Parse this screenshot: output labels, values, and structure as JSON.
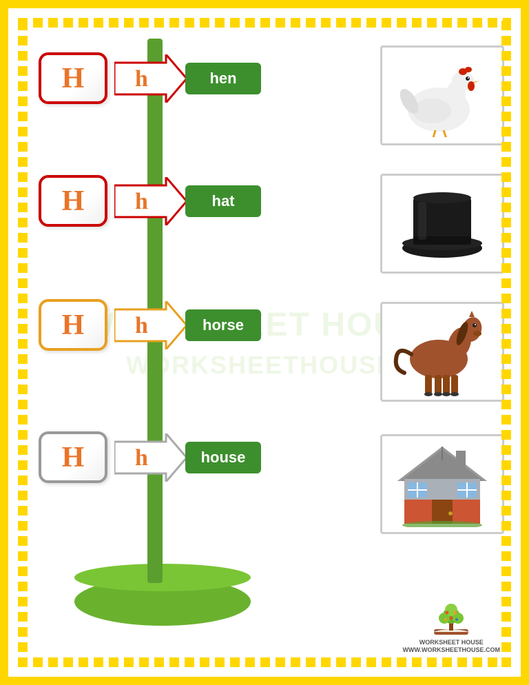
{
  "border": {
    "color": "gold"
  },
  "rows": [
    {
      "id": "row1",
      "capital": "H",
      "lowercase": "h",
      "word": "hen",
      "color_scheme": "red",
      "image_alt": "hen",
      "image_emoji": "🐓"
    },
    {
      "id": "row2",
      "capital": "H",
      "lowercase": "h",
      "word": "hat",
      "color_scheme": "red",
      "image_alt": "hat",
      "image_emoji": "🎩"
    },
    {
      "id": "row3",
      "capital": "H",
      "lowercase": "h",
      "word": "horse",
      "color_scheme": "orange",
      "image_alt": "horse",
      "image_emoji": "🐎"
    },
    {
      "id": "row4",
      "capital": "H",
      "lowercase": "h",
      "word": "house",
      "color_scheme": "gray",
      "image_alt": "house",
      "image_emoji": "🏠"
    }
  ],
  "watermark": {
    "line1": "WORKSHEET HOUSE",
    "line2": "WORKSHEETHOUSE."
  },
  "logo": {
    "name": "WORKSHEET HOUSE",
    "url_text": "WWW.WORKSHEETHOUSE.COM"
  }
}
